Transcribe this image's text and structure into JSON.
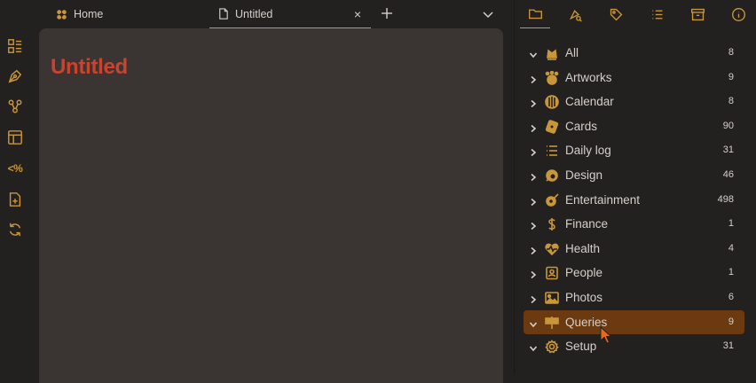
{
  "colors": {
    "accent": "#c9963a",
    "title": "#c9432d",
    "selected_bg": "#6b3a10",
    "editor_bg": "#3a3533",
    "app_bg": "#232120"
  },
  "tabs": [
    {
      "label": "Home",
      "icon": "home-icon"
    },
    {
      "label": "Untitled",
      "icon": "file-icon",
      "close": "×"
    }
  ],
  "ribbon": {
    "formula_label": "<%"
  },
  "note": {
    "title": "Untitled"
  },
  "folders": [
    {
      "label": "All",
      "count": "8",
      "icon": "crown-icon"
    },
    {
      "label": "Artworks",
      "count": "9",
      "icon": "palette-icon"
    },
    {
      "label": "Calendar",
      "count": "8",
      "icon": "calendar-icon"
    },
    {
      "label": "Cards",
      "count": "90",
      "icon": "card-icon"
    },
    {
      "label": "Daily log",
      "count": "31",
      "icon": "list-icon"
    },
    {
      "label": "Design",
      "count": "46",
      "icon": "design-icon"
    },
    {
      "label": "Entertainment",
      "count": "498",
      "icon": "entertainment-icon"
    },
    {
      "label": "Finance",
      "count": "1",
      "icon": "dollar-icon"
    },
    {
      "label": "Health",
      "count": "4",
      "icon": "heart-icon"
    },
    {
      "label": "People",
      "count": "1",
      "icon": "person-icon"
    },
    {
      "label": "Photos",
      "count": "6",
      "icon": "image-icon"
    },
    {
      "label": "Queries",
      "count": "9",
      "icon": "signpost-icon"
    },
    {
      "label": "Setup",
      "count": "31",
      "icon": "gear-icon"
    }
  ]
}
